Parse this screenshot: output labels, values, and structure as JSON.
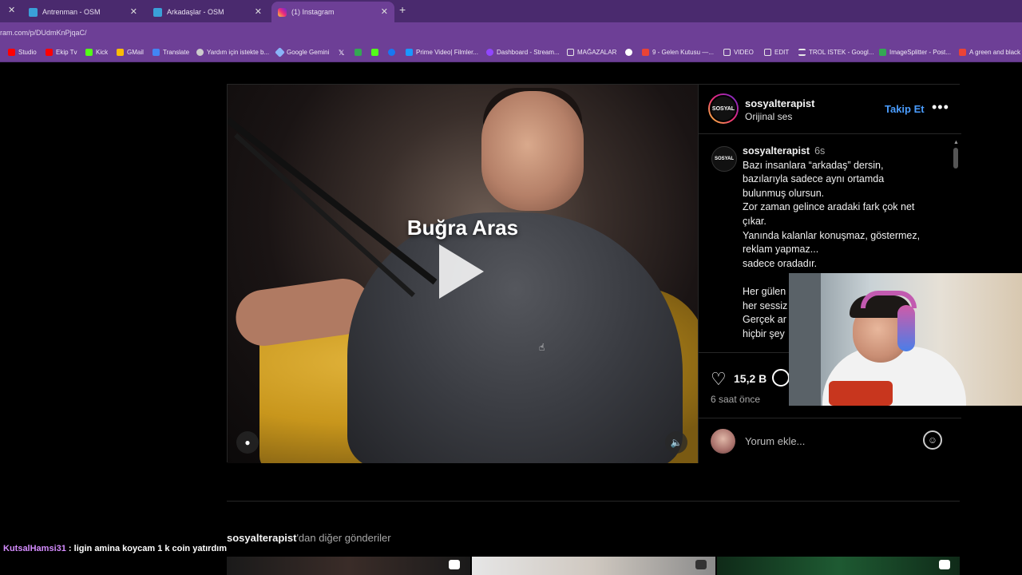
{
  "browser": {
    "tabs": [
      {
        "title": "Antrenman - OSM",
        "color": "#3aa0d8"
      },
      {
        "title": "Arkadaşlar - OSM",
        "color": "#3aa0d8"
      },
      {
        "title": "(1) Instagram",
        "color": "#e1306c"
      }
    ],
    "url": "ram.com/p/DUdmKnPjqaC/",
    "bookmarks": [
      {
        "label": "Studio",
        "color": "#ff0000"
      },
      {
        "label": "Ekip Tv",
        "color": "#ff0000"
      },
      {
        "label": "Kick",
        "color": "#53fc18"
      },
      {
        "label": "GMail",
        "color": "#ffffff"
      },
      {
        "label": "Translate",
        "color": "#4285f4"
      },
      {
        "label": "Yardım için istekte b...",
        "color": "#cccccc"
      },
      {
        "label": "Google Gemini",
        "color": "#8ab4f8"
      },
      {
        "label": "",
        "color": "#000000"
      },
      {
        "label": "",
        "color": "#34a853"
      },
      {
        "label": "",
        "color": "#53fc18"
      },
      {
        "label": "",
        "color": "#1877f2"
      },
      {
        "label": "Prime Video| Filmler...",
        "color": "#1a98ff"
      },
      {
        "label": "Dashboard - Stream...",
        "color": "#9146ff"
      },
      {
        "label": "MAĞAZALAR",
        "color": "#e8e8e8"
      },
      {
        "label": "",
        "color": "#ffffff"
      },
      {
        "label": "9 - Gelen Kutusu —...",
        "color": "#ea4335"
      },
      {
        "label": "VIDEO",
        "color": "#e8e8e8"
      },
      {
        "label": "EDIT",
        "color": "#e8e8e8"
      },
      {
        "label": "TROL ISTEK - Googl...",
        "color": "#e8e8e8"
      },
      {
        "label": "ImageSplitter - Post...",
        "color": "#34a853"
      },
      {
        "label": "A green and black",
        "color": "#ea4335"
      }
    ]
  },
  "post": {
    "video_overlay_text": "Buğra Aras",
    "author": "sosyalterapist",
    "audio": "Orijinal ses",
    "follow_label": "Takip Et",
    "avatar_text": "SOSYAL",
    "caption_time": "6s",
    "caption_lines": [
      "Bazı insanlara “arkadaş” dersin,",
      "bazılarıyla sadece aynı ortamda",
      "bulunmuş olursun.",
      "Zor zaman gelince aradaki fark çok net",
      "çıkar.",
      "Yanında kalanlar konuşmaz, göstermez,",
      "reklam yapmaz...",
      "sadece oradadır.",
      "",
      "Her gülen",
      "her sessiz",
      "Gerçek ar",
      "hiçbir şey"
    ],
    "likes": "15,2 B",
    "posted_ago": "6 saat önce",
    "comment_placeholder": "Yorum ekle..."
  },
  "more_posts": {
    "author": "sosyalterapist",
    "suffix": "'dan diğer gönderiler"
  },
  "chat": {
    "user": "KutsalHamsi31",
    "message": " : ligin amina koycam 1 k coin yatırdım"
  }
}
